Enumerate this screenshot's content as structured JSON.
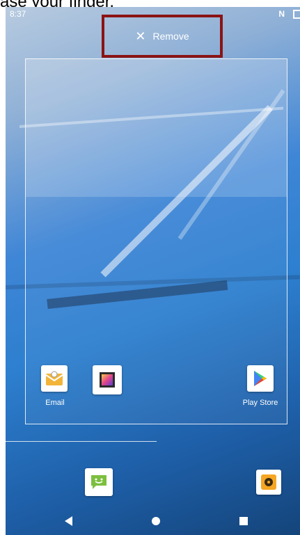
{
  "caption": {
    "text": "ase your finger."
  },
  "status_bar": {
    "time": "8:37",
    "nfc": "N"
  },
  "remove_target": {
    "label": "Remove",
    "icon": "close-icon"
  },
  "preview_apps": [
    {
      "label": "Email",
      "icon": "email-icon"
    },
    {
      "label": "",
      "icon": "gallery-icon"
    },
    {
      "label": "Play Store",
      "icon": "play-store-icon"
    }
  ],
  "dock_apps": [
    {
      "icon": "messaging-icon"
    },
    {
      "icon": "music-icon"
    }
  ],
  "nav": {
    "back": "back-icon",
    "home": "home-icon",
    "recents": "recents-icon"
  },
  "colors": {
    "highlight_border": "#8b1414",
    "wallpaper_blue": "#2d7fcf"
  }
}
